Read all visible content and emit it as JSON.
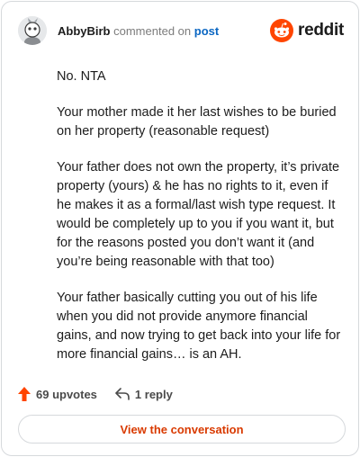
{
  "header": {
    "username": "AbbyBirb",
    "action": "commented on",
    "post_link": "post",
    "brand": "reddit",
    "brand_color": "#ff4500"
  },
  "comment": {
    "paragraphs": [
      "No. NTA",
      "Your mother made it her last wishes to be buried on her property (reasonable request)",
      "Your father does not own the property, it’s private property (yours) & he has no rights to it, even if he makes it as a formal/last wish type request. It would be completely up to you if you want it, but for the reasons posted you don’t want it (and you’re being reasonable with that too)",
      "Your father basically cutting you out of his life when you did not provide anymore financial gains, and now trying to get back into your life for more financial gains… is an AH."
    ]
  },
  "footer": {
    "upvotes": "69 upvotes",
    "replies": "1 reply",
    "upvote_color": "#ff4500"
  },
  "cta": {
    "label": "View the conversation"
  },
  "icons": {
    "avatar": "snoo-avatar-icon",
    "logo": "reddit-logo-icon",
    "upvote": "upvote-arrow-icon",
    "reply": "reply-arrow-icon"
  }
}
